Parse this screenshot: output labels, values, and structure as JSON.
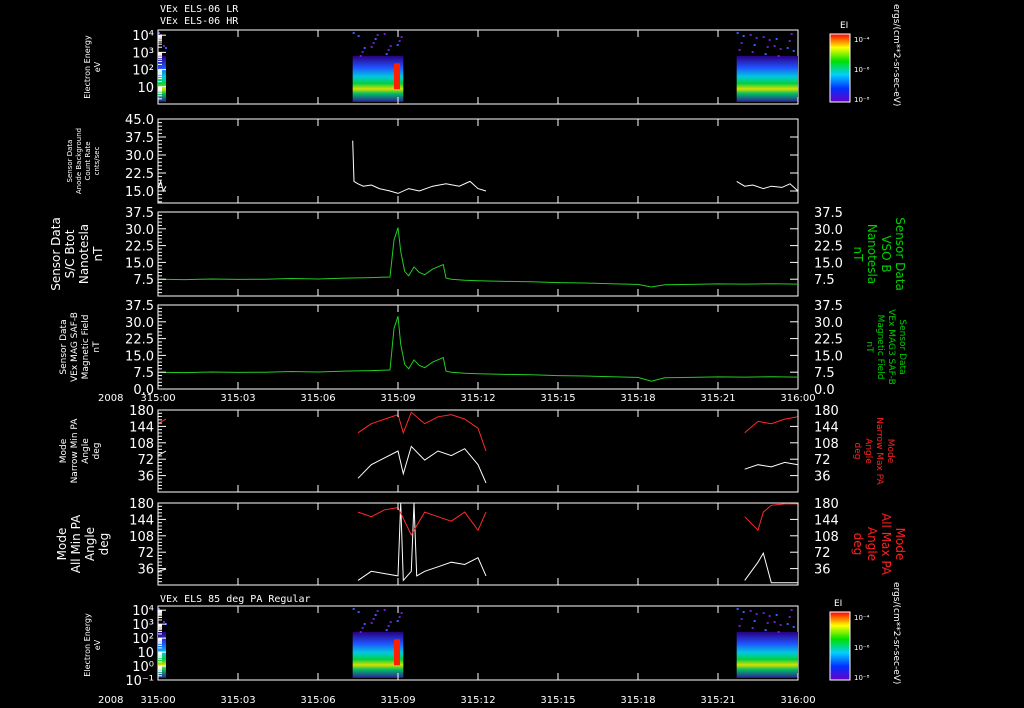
{
  "header": {
    "line1": "VEx ELS-06 LR",
    "line2": "VEx ELS-06 HR"
  },
  "colors": {
    "background": "#000000",
    "frame": "#ffffff",
    "white_trace": "#ffffff",
    "green_trace": "#22cc22",
    "red_trace": "#ff2a2a",
    "label_green": "#00d000",
    "label_red": "#ff2020"
  },
  "time_axis": {
    "year": "2008",
    "ticks": [
      "315:00",
      "315:03",
      "315:06",
      "315:09",
      "315:12",
      "315:15",
      "315:18",
      "315:21",
      "316:00"
    ]
  },
  "colorbar": {
    "title": "EI",
    "ticks": [
      "10⁻⁴",
      "10⁻⁶",
      "10⁻⁸"
    ],
    "units": "ergs/(cm**2-sr-sec-eV)"
  },
  "panels": {
    "p1": {
      "label": [
        "Electron Energy",
        "eV"
      ],
      "yticks": [
        "10⁴",
        "10³",
        "10²",
        "10"
      ]
    },
    "p2": {
      "label": [
        "Sensor Data",
        "Anode Background",
        "Count Rate",
        "cnts/sec"
      ],
      "yticks": [
        "45.0",
        "37.5",
        "30.0",
        "22.5",
        "15.0"
      ]
    },
    "p3": {
      "label": [
        "Sensor Data",
        "S/C Btot",
        "Nanotesla",
        "nT"
      ],
      "right_label": [
        "Sensor Data",
        "VSO B",
        "Nanotesla",
        "nT"
      ],
      "yticks": [
        "37.5",
        "30.0",
        "22.5",
        "15.0",
        "7.5"
      ]
    },
    "p4": {
      "label": [
        "Sensor Data",
        "VEx MAG SAF-B",
        "Magnetic Field",
        "nT"
      ],
      "right_label": [
        "Sensor Data",
        "VEx MAG3 SAF-B",
        "Magnetic Field",
        "nT"
      ],
      "yticks": [
        "37.5",
        "30.0",
        "22.5",
        "15.0",
        "7.5",
        "0.0"
      ]
    },
    "p5": {
      "label": [
        "Mode",
        "Narrow Min PA",
        "Angle",
        "deg"
      ],
      "right_label": [
        "Mode",
        "Narrow Max PA",
        "Angle",
        "deg"
      ],
      "yticks": [
        "180",
        "144",
        "108",
        "72",
        "36"
      ]
    },
    "p6": {
      "label": [
        "Mode",
        "All Min PA",
        "Angle",
        "deg"
      ],
      "right_label": [
        "Mode",
        "All Max PA",
        "Angle",
        "deg"
      ],
      "yticks": [
        "180",
        "144",
        "108",
        "72",
        "36"
      ]
    },
    "p7": {
      "title": "VEx ELS 85 deg PA Regular",
      "label": [
        "Electron Energy",
        "eV"
      ],
      "yticks": [
        "10⁴",
        "10³",
        "10²",
        "10",
        "10⁰",
        "10⁻¹"
      ]
    }
  },
  "chart_data": [
    {
      "type": "heatmap",
      "panel": "p1",
      "ylabel": "Electron Energy eV",
      "yscale": "log",
      "ylim": [
        1,
        20000
      ],
      "data_intervals_hours": [
        [
          0.0,
          0.3
        ],
        [
          7.3,
          9.2
        ],
        [
          21.7,
          24.0
        ]
      ],
      "colorbar_title": "EI",
      "colorbar_range": [
        1e-08,
        0.0001
      ]
    },
    {
      "type": "line",
      "panel": "p2",
      "ylabel": "Sensor Data Anode Background Count Rate cnts/sec",
      "ylim": [
        10,
        45
      ],
      "segments": [
        {
          "x": [
            0.0,
            0.1,
            0.2,
            0.3
          ],
          "y": [
            16,
            19,
            15,
            17
          ]
        },
        {
          "x": [
            7.3,
            7.35,
            7.5,
            7.7,
            8.0,
            8.3,
            8.7,
            9.0,
            9.4,
            9.8,
            10.3,
            10.8,
            11.3,
            11.7,
            12.0,
            12.3
          ],
          "y": [
            36,
            19,
            18,
            17,
            17.5,
            16,
            15,
            14,
            16,
            15,
            17,
            18,
            17,
            19,
            16,
            15
          ]
        },
        {
          "x": [
            21.7,
            22.0,
            22.3,
            22.7,
            23.0,
            23.4,
            23.7,
            24.0
          ],
          "y": [
            19,
            17,
            17.5,
            16,
            17,
            16.5,
            18,
            15
          ]
        }
      ]
    },
    {
      "type": "line",
      "panel": "p3",
      "ylabel": "Sensor Data S/C Btot Nanotesla nT",
      "ylim": [
        0,
        37.5
      ],
      "x": [
        0.0,
        1.0,
        2.0,
        3.0,
        4.0,
        5.0,
        6.0,
        7.0,
        8.0,
        8.7,
        8.85,
        9.0,
        9.1,
        9.25,
        9.4,
        9.6,
        9.8,
        10.0,
        10.3,
        10.7,
        10.8,
        11.0,
        11.5,
        12.0,
        13.0,
        14.0,
        15.0,
        16.0,
        17.0,
        18.0,
        18.5,
        19.0,
        20.0,
        21.0,
        22.0,
        23.0,
        24.0
      ],
      "y": [
        7.5,
        7.3,
        7.6,
        7.4,
        7.5,
        7.8,
        7.6,
        8.0,
        8.2,
        8.5,
        25.0,
        30.5,
        20.0,
        11.0,
        9.0,
        13.0,
        10.5,
        9.5,
        12.0,
        14.0,
        8.0,
        7.5,
        7.0,
        6.8,
        6.5,
        6.4,
        6.0,
        5.8,
        5.5,
        5.2,
        4.0,
        5.0,
        5.2,
        5.4,
        5.3,
        5.5,
        5.3
      ]
    },
    {
      "type": "line",
      "panel": "p4",
      "ylabel": "Sensor Data VEx MAG SAF-B Magnetic Field nT",
      "ylim": [
        0,
        37.5
      ],
      "x": [
        0.0,
        1.0,
        2.0,
        3.0,
        4.0,
        5.0,
        6.0,
        7.0,
        8.0,
        8.7,
        8.85,
        9.0,
        9.1,
        9.25,
        9.4,
        9.6,
        9.8,
        10.0,
        10.3,
        10.7,
        10.8,
        11.0,
        11.5,
        12.0,
        13.0,
        14.0,
        15.0,
        16.0,
        17.0,
        18.0,
        18.5,
        19.0,
        20.0,
        21.0,
        22.0,
        23.0,
        24.0
      ],
      "y": [
        7.5,
        7.3,
        7.6,
        7.4,
        7.5,
        7.8,
        7.6,
        8.0,
        8.2,
        8.5,
        27.0,
        32.5,
        20.0,
        11.0,
        9.0,
        13.0,
        10.5,
        9.5,
        12.0,
        14.0,
        8.0,
        7.5,
        7.0,
        6.8,
        6.5,
        6.4,
        6.0,
        5.8,
        5.5,
        5.2,
        3.5,
        5.0,
        5.2,
        5.4,
        5.3,
        5.5,
        5.3
      ]
    },
    {
      "type": "line",
      "panel": "p5",
      "ylabel": "Mode Narrow Min/Max PA Angle deg",
      "ylim": [
        0,
        180
      ],
      "series": [
        {
          "color": "white",
          "x": [
            0.0,
            0.3
          ],
          "y": [
            80,
            90
          ]
        },
        {
          "color": "white",
          "x": [
            7.5,
            8.0,
            8.5,
            9.0,
            9.2,
            9.5,
            10.0,
            10.5,
            11.0,
            11.5,
            12.0,
            12.3
          ],
          "y": [
            30,
            60,
            75,
            90,
            40,
            100,
            70,
            90,
            80,
            95,
            60,
            20
          ]
        },
        {
          "color": "white",
          "x": [
            22.0,
            22.5,
            23.0,
            23.5,
            24.0
          ],
          "y": [
            50,
            60,
            55,
            65,
            60
          ]
        },
        {
          "color": "red",
          "x": [
            0.0,
            0.3
          ],
          "y": [
            150,
            160
          ]
        },
        {
          "color": "red",
          "x": [
            7.5,
            8.0,
            8.5,
            9.0,
            9.2,
            9.5,
            10.0,
            10.5,
            11.0,
            11.5,
            12.0,
            12.3
          ],
          "y": [
            130,
            150,
            160,
            170,
            130,
            175,
            150,
            165,
            170,
            160,
            140,
            90
          ]
        },
        {
          "color": "red",
          "x": [
            22.0,
            22.5,
            23.0,
            23.5,
            24.0
          ],
          "y": [
            130,
            155,
            150,
            160,
            165
          ]
        }
      ]
    },
    {
      "type": "line",
      "panel": "p6",
      "ylabel": "Mode All Min/Max PA Angle deg",
      "ylim": [
        0,
        180
      ],
      "series": [
        {
          "color": "white",
          "x": [
            0.0,
            0.3
          ],
          "y": [
            30,
            35
          ]
        },
        {
          "color": "white",
          "x": [
            7.5,
            8.0,
            8.5,
            9.0,
            9.1,
            9.2,
            9.5,
            9.6,
            9.7,
            10.0,
            10.5,
            11.0,
            11.5,
            12.0,
            12.3
          ],
          "y": [
            10,
            30,
            25,
            20,
            180,
            10,
            30,
            180,
            20,
            30,
            40,
            50,
            45,
            60,
            20
          ]
        },
        {
          "color": "white",
          "x": [
            22.0,
            22.5,
            22.7,
            23.0,
            23.5,
            24.0
          ],
          "y": [
            10,
            50,
            70,
            5,
            5,
            5
          ]
        },
        {
          "color": "red",
          "x": [
            7.5,
            8.0,
            8.5,
            9.0,
            9.5,
            10.0,
            10.5,
            11.0,
            11.5,
            12.0,
            12.3
          ],
          "y": [
            160,
            150,
            165,
            170,
            110,
            160,
            150,
            140,
            160,
            120,
            160
          ]
        },
        {
          "color": "red",
          "x": [
            22.0,
            22.5,
            22.7,
            23.0,
            23.5,
            24.0
          ],
          "y": [
            150,
            120,
            160,
            175,
            178,
            178
          ]
        }
      ]
    },
    {
      "type": "heatmap",
      "panel": "p7",
      "title": "VEx ELS 85 deg PA Regular",
      "ylabel": "Electron Energy eV",
      "yscale": "log",
      "ylim": [
        0.1,
        20000
      ],
      "data_intervals_hours": [
        [
          0.0,
          0.3
        ],
        [
          7.3,
          9.2
        ],
        [
          21.7,
          24.0
        ]
      ],
      "colorbar_title": "EI",
      "colorbar_range": [
        1e-08,
        0.0001
      ]
    }
  ]
}
